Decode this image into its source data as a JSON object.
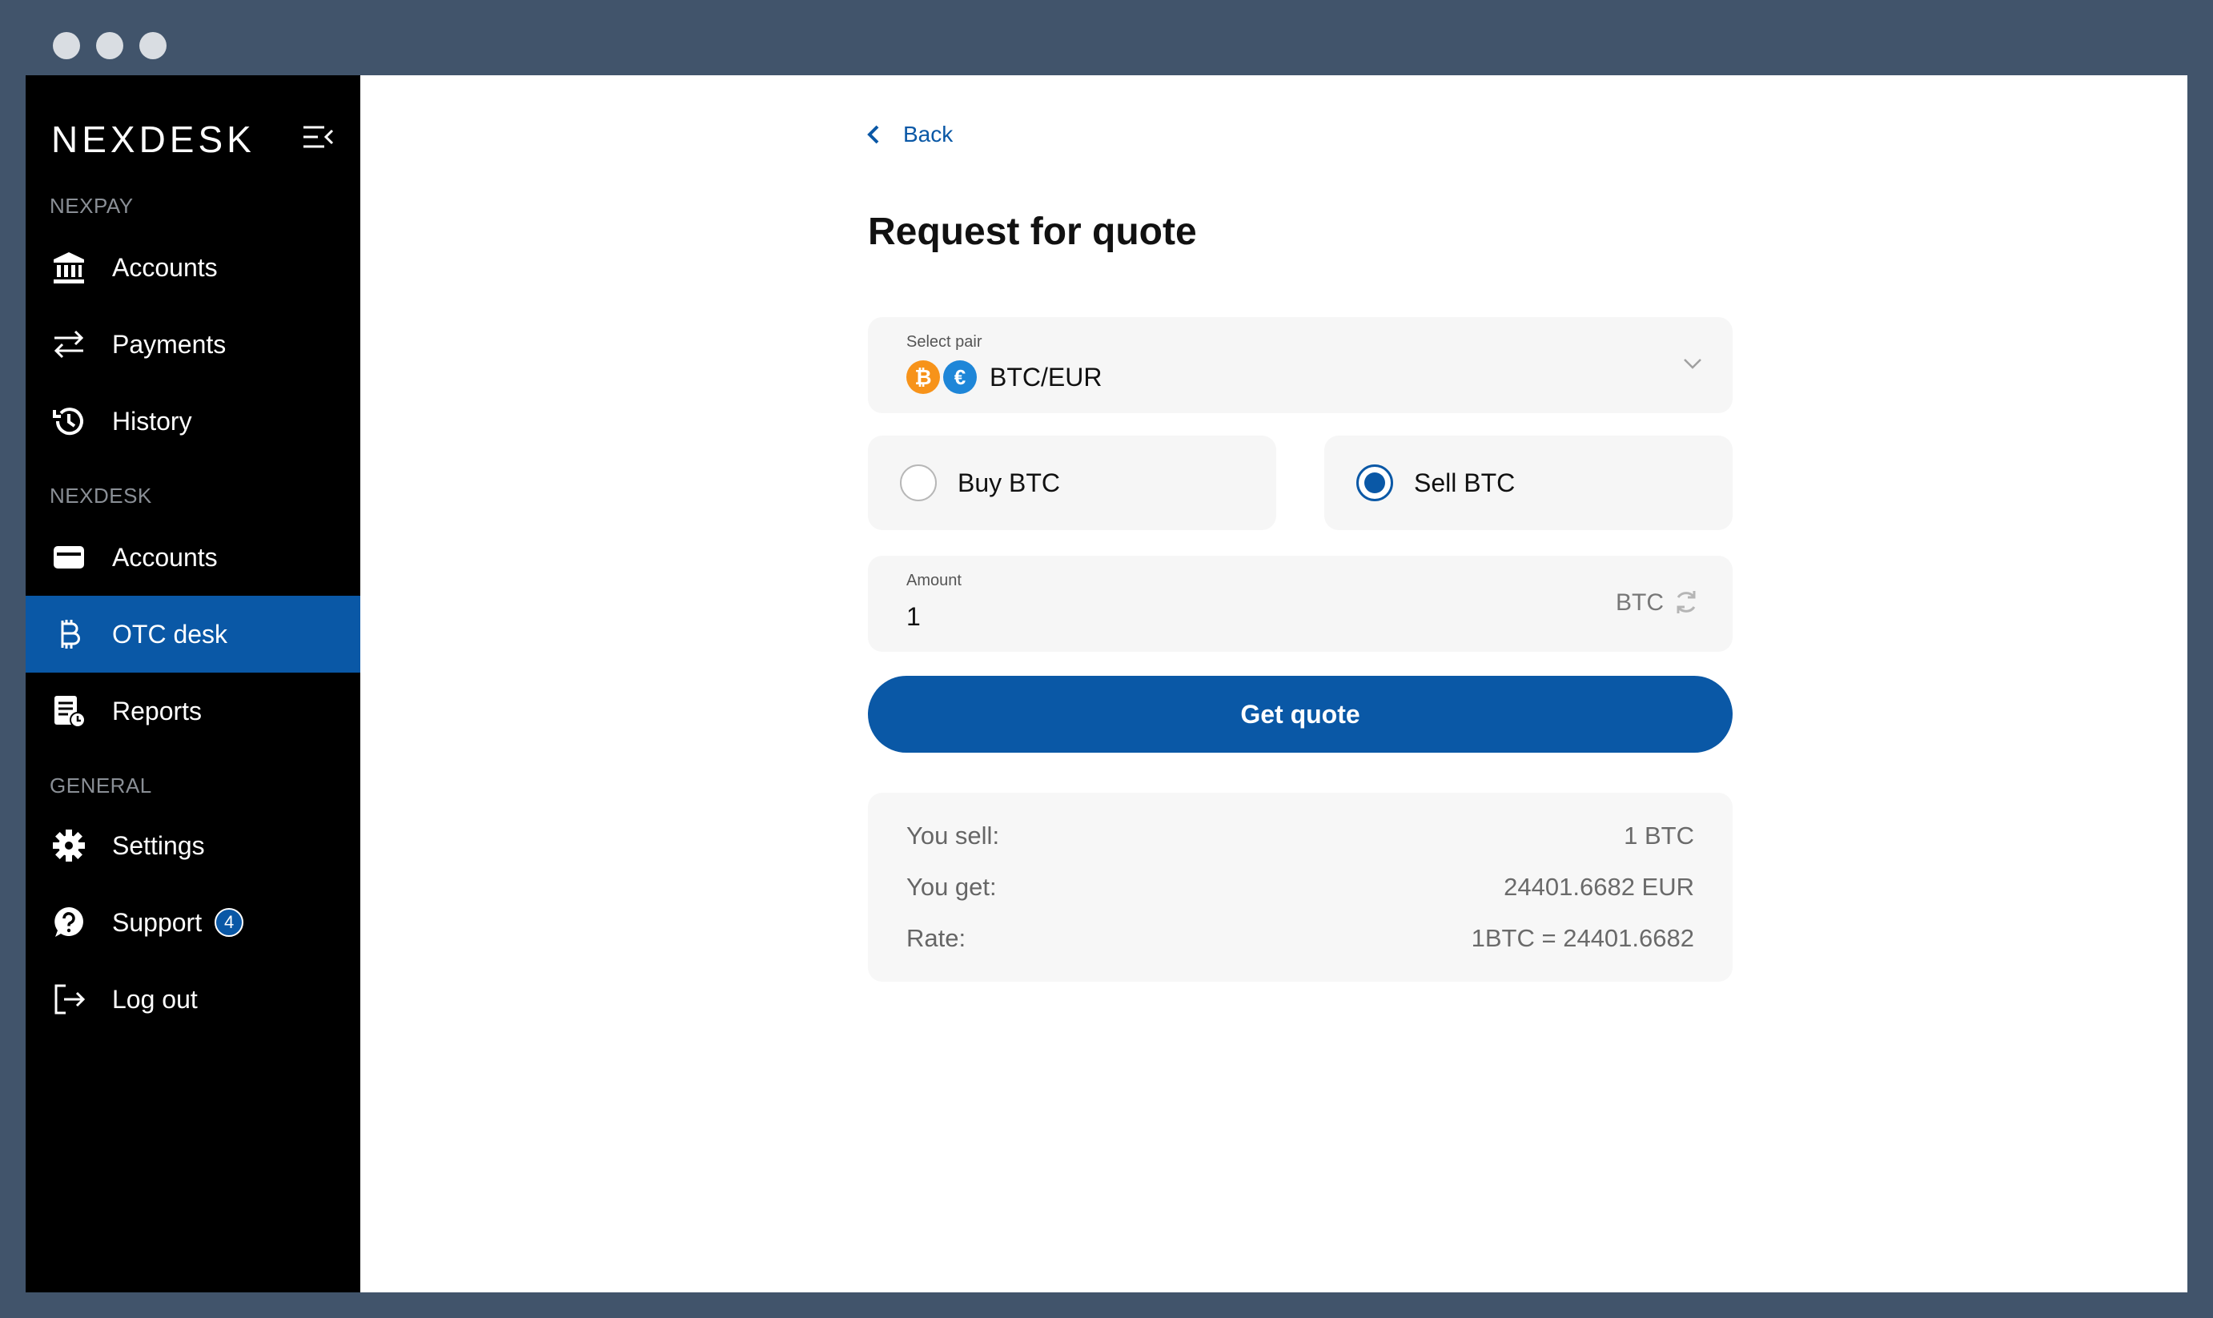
{
  "sidebar": {
    "logo": "NEXDESK",
    "sections": [
      {
        "label": "NEXPAY"
      },
      {
        "label": "NEXDESK"
      },
      {
        "label": "GENERAL"
      }
    ],
    "items": [
      {
        "label": "Accounts",
        "icon": "bank-icon"
      },
      {
        "label": "Payments",
        "icon": "transfer-arrows-icon"
      },
      {
        "label": "History",
        "icon": "history-icon"
      },
      {
        "label": "Accounts",
        "icon": "wallet-icon"
      },
      {
        "label": "OTC desk",
        "icon": "bitcoin-icon",
        "active": true
      },
      {
        "label": "Reports",
        "icon": "report-icon"
      },
      {
        "label": "Settings",
        "icon": "gear-icon"
      },
      {
        "label": "Support",
        "icon": "help-icon",
        "badge": "4"
      },
      {
        "label": "Log out",
        "icon": "logout-icon"
      }
    ]
  },
  "main": {
    "back_label": "Back",
    "title": "Request for quote",
    "pair_select": {
      "label": "Select pair",
      "value": "BTC/EUR",
      "coin_a_symbol": "₿",
      "coin_b_symbol": "€"
    },
    "side_options": [
      {
        "label": "Buy BTC",
        "selected": false
      },
      {
        "label": "Sell BTC",
        "selected": true
      }
    ],
    "amount": {
      "label": "Amount",
      "value": "1",
      "unit": "BTC"
    },
    "quote_button": "Get quote",
    "summary": [
      {
        "key": "You sell:",
        "value": "1 BTC"
      },
      {
        "key": "You get:",
        "value": "24401.6682 EUR"
      },
      {
        "key": "Rate:",
        "value": "1BTC = 24401.6682"
      }
    ]
  },
  "colors": {
    "accent": "#0a58a6",
    "sidebar_bg": "#000000",
    "frame_bg": "#41546b",
    "btc_orange": "#f7931a",
    "eur_blue": "#1e86d8"
  }
}
